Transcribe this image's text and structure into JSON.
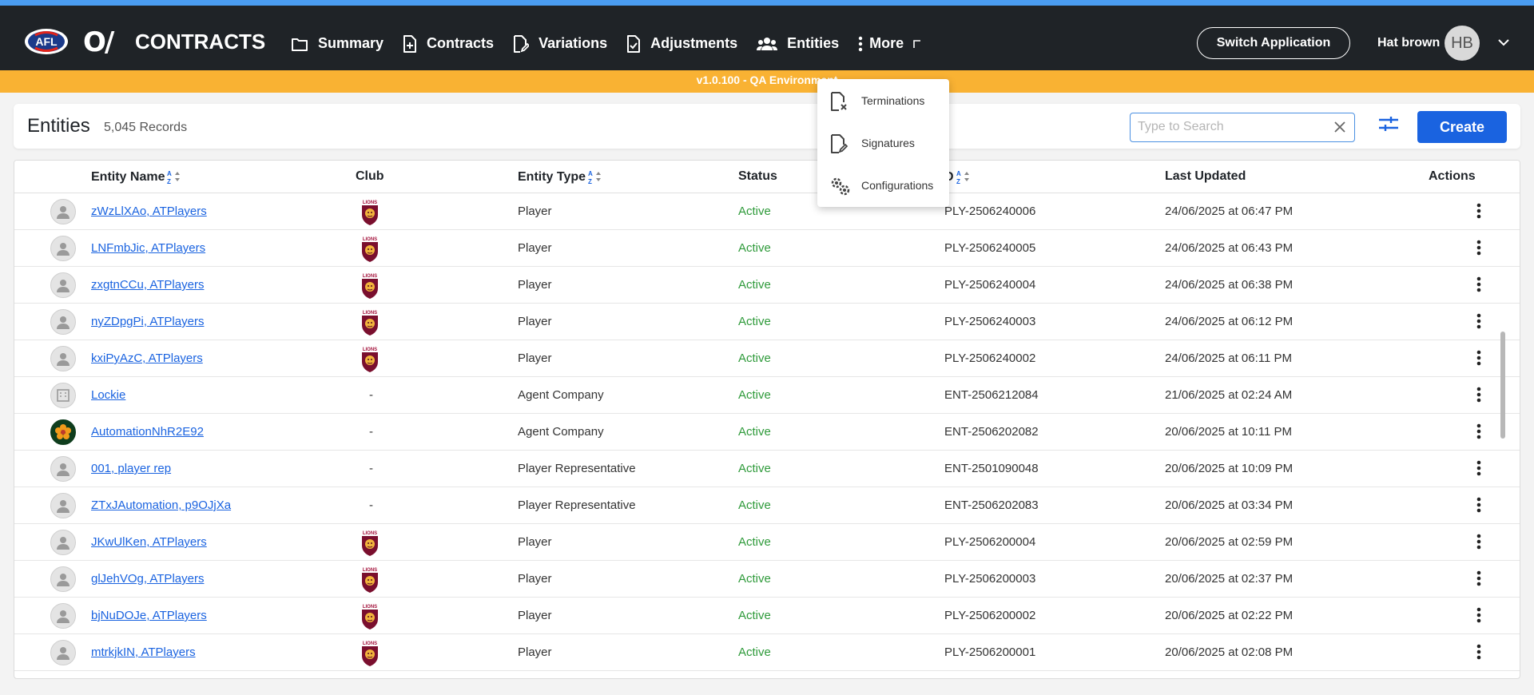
{
  "app": {
    "title": "CONTRACTS",
    "brand_logo": "AFL",
    "ol_logo": "O/"
  },
  "nav": {
    "items": [
      {
        "label": "Summary",
        "icon": "folder-icon"
      },
      {
        "label": "Contracts",
        "icon": "document-plus-icon"
      },
      {
        "label": "Variations",
        "icon": "document-edit-icon"
      },
      {
        "label": "Adjustments",
        "icon": "document-check-icon"
      },
      {
        "label": "Entities",
        "icon": "people-icon",
        "active": true
      },
      {
        "label": "More",
        "icon": "more-vertical-icon"
      }
    ]
  },
  "header": {
    "switch_label": "Switch Application",
    "user_name": "Hat brown",
    "user_initials": "HB"
  },
  "env_banner": "v1.0.100 - QA Environment",
  "toolbar": {
    "title": "Entities",
    "count": "5,045 Records",
    "search_placeholder": "Type to Search",
    "create_label": "Create"
  },
  "more_menu": {
    "items": [
      {
        "label": "Terminations",
        "icon": "document-x-icon"
      },
      {
        "label": "Signatures",
        "icon": "document-sign-icon"
      },
      {
        "label": "Configurations",
        "icon": "gears-icon"
      }
    ]
  },
  "table": {
    "columns": {
      "name": "Entity Name",
      "club": "Club",
      "type": "Entity Type",
      "status": "Status",
      "id": "D",
      "updated": "Last Updated",
      "actions": "Actions"
    },
    "rows": [
      {
        "name": "zWzLlXAo, ATPlayers",
        "club": "lions",
        "type": "Player",
        "status": "Active",
        "id": "PLY-2506240006",
        "updated": "24/06/2025 at 06:47 PM",
        "avatar": "person"
      },
      {
        "name": "LNFmbJic, ATPlayers",
        "club": "lions",
        "type": "Player",
        "status": "Active",
        "id": "PLY-2506240005",
        "updated": "24/06/2025 at 06:43 PM",
        "avatar": "person"
      },
      {
        "name": "zxgtnCCu, ATPlayers",
        "club": "lions",
        "type": "Player",
        "status": "Active",
        "id": "PLY-2506240004",
        "updated": "24/06/2025 at 06:38 PM",
        "avatar": "person"
      },
      {
        "name": "nyZDpgPi, ATPlayers",
        "club": "lions",
        "type": "Player",
        "status": "Active",
        "id": "PLY-2506240003",
        "updated": "24/06/2025 at 06:12 PM",
        "avatar": "person"
      },
      {
        "name": "kxiPyAzC, ATPlayers",
        "club": "lions",
        "type": "Player",
        "status": "Active",
        "id": "PLY-2506240002",
        "updated": "24/06/2025 at 06:11 PM",
        "avatar": "person"
      },
      {
        "name": "Lockie",
        "club": "-",
        "type": "Agent Company",
        "status": "Active",
        "id": "ENT-2506212084",
        "updated": "21/06/2025 at 02:24 AM",
        "avatar": "building"
      },
      {
        "name": "AutomationNhR2E92",
        "club": "-",
        "type": "Agent Company",
        "status": "Active",
        "id": "ENT-2506202082",
        "updated": "20/06/2025 at 10:11 PM",
        "avatar": "flower"
      },
      {
        "name": "001, player rep",
        "club": "-",
        "type": "Player Representative",
        "status": "Active",
        "id": "ENT-2501090048",
        "updated": "20/06/2025 at 10:09 PM",
        "avatar": "person"
      },
      {
        "name": "ZTxJAutomation, p9OJjXa",
        "club": "-",
        "type": "Player Representative",
        "status": "Active",
        "id": "ENT-2506202083",
        "updated": "20/06/2025 at 03:34 PM",
        "avatar": "person"
      },
      {
        "name": "JKwUlKen, ATPlayers",
        "club": "lions",
        "type": "Player",
        "status": "Active",
        "id": "PLY-2506200004",
        "updated": "20/06/2025 at 02:59 PM",
        "avatar": "person"
      },
      {
        "name": "glJehVOg, ATPlayers",
        "club": "lions",
        "type": "Player",
        "status": "Active",
        "id": "PLY-2506200003",
        "updated": "20/06/2025 at 02:37 PM",
        "avatar": "person"
      },
      {
        "name": "bjNuDOJe, ATPlayers",
        "club": "lions",
        "type": "Player",
        "status": "Active",
        "id": "PLY-2506200002",
        "updated": "20/06/2025 at 02:22 PM",
        "avatar": "person"
      },
      {
        "name": "mtrkjkIN, ATPlayers",
        "club": "lions",
        "type": "Player",
        "status": "Active",
        "id": "PLY-2506200001",
        "updated": "20/06/2025 at 02:08 PM",
        "avatar": "person"
      }
    ]
  },
  "colors": {
    "header_bg": "#1f2327",
    "accent_blue": "#1a63e0",
    "env_banner": "#f9b233",
    "status_active": "#2e9a3a",
    "top_strip": "#4a9cf0"
  }
}
